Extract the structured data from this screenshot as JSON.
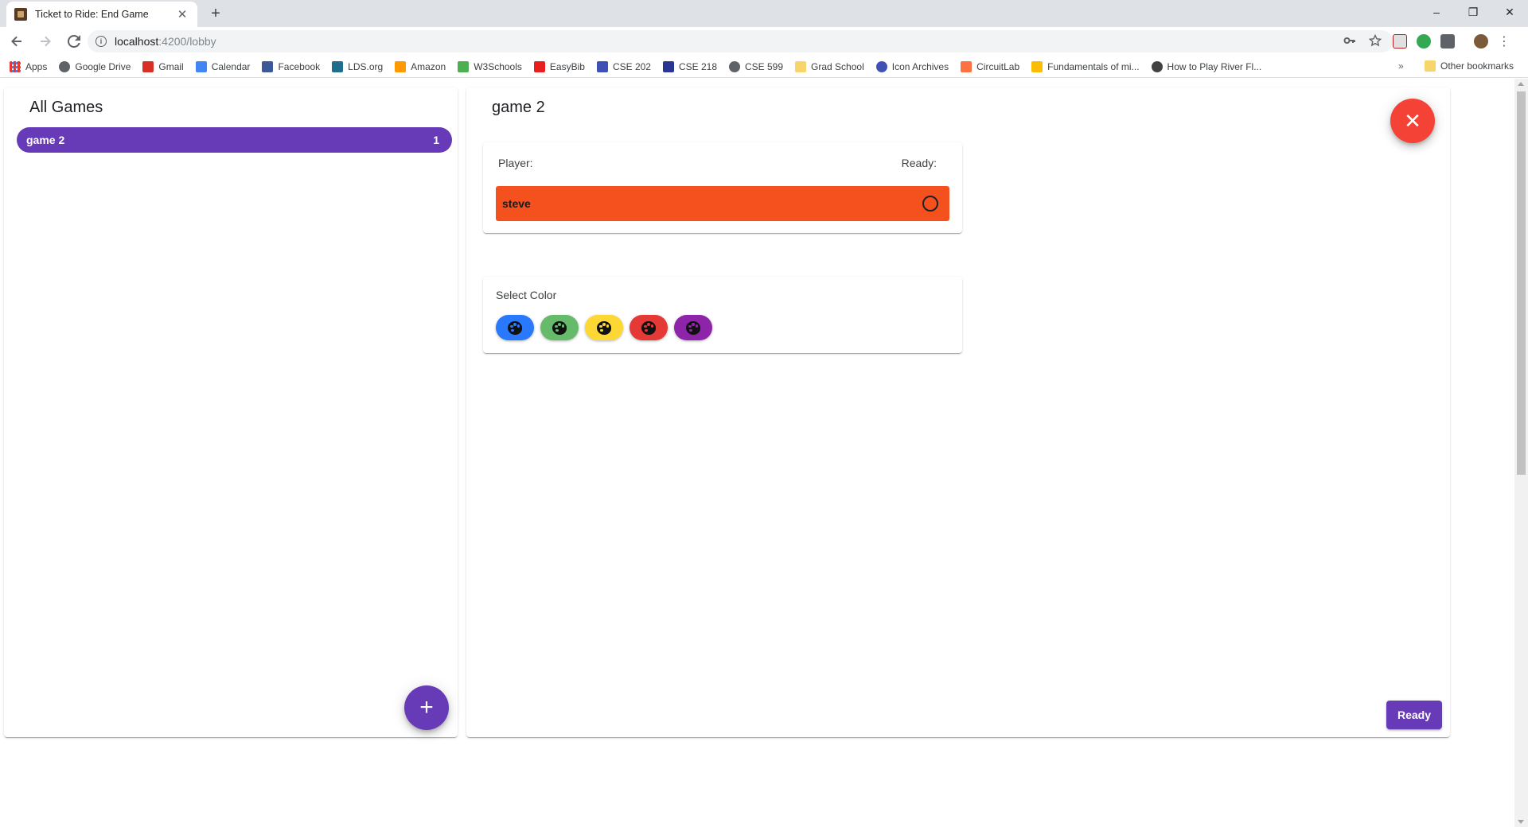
{
  "browser": {
    "tab_title": "Ticket to Ride: End Game",
    "tab_close": "✕",
    "new_tab": "+",
    "url_host": "localhost",
    "url_path": ":4200/lobby",
    "window_controls": [
      "–",
      "❐",
      "✕"
    ]
  },
  "bookmarks": {
    "items": [
      {
        "label": "Apps",
        "icon": "apps-grid-icon",
        "color": "#e53935"
      },
      {
        "label": "Google Drive",
        "icon": "drive-icon",
        "color": "#5f6368"
      },
      {
        "label": "Gmail",
        "icon": "gmail-icon",
        "color": "#d93025"
      },
      {
        "label": "Calendar",
        "icon": "calendar-icon",
        "color": "#4285f4"
      },
      {
        "label": "Facebook",
        "icon": "facebook-icon",
        "color": "#3b5998"
      },
      {
        "label": "LDS.org",
        "icon": "lds-icon",
        "color": "#1e6e8c"
      },
      {
        "label": "Amazon",
        "icon": "amazon-icon",
        "color": "#ff9900"
      },
      {
        "label": "W3Schools",
        "icon": "w3schools-icon",
        "color": "#4caf50"
      },
      {
        "label": "EasyBib",
        "icon": "easybib-icon",
        "color": "#e91e1e"
      },
      {
        "label": "CSE 202",
        "icon": "cse202-icon",
        "color": "#3f51b5"
      },
      {
        "label": "CSE 218",
        "icon": "cse218-icon",
        "color": "#283593"
      },
      {
        "label": "CSE 599",
        "icon": "cse599-icon",
        "color": "#5f6368"
      },
      {
        "label": "Grad School",
        "icon": "folder-icon",
        "color": "#f9d46a"
      },
      {
        "label": "Icon Archives",
        "icon": "icon-archives-icon",
        "color": "#3f51b5"
      },
      {
        "label": "CircuitLab",
        "icon": "circuitlab-icon",
        "color": "#ff7043"
      },
      {
        "label": "Fundamentals of mi...",
        "icon": "drive-icon",
        "color": "#fbbc04"
      },
      {
        "label": "How to Play River Fl...",
        "icon": "river-icon",
        "color": "#424242"
      }
    ],
    "overflow": "»",
    "other_label": "Other bookmarks"
  },
  "lobby": {
    "title": "All Games",
    "games": [
      {
        "name": "game 2",
        "count": "1"
      }
    ],
    "add_label": "+"
  },
  "game": {
    "title": "game 2",
    "close_label": "✕",
    "player_header": "Player:",
    "ready_header": "Ready:",
    "players": [
      {
        "name": "steve",
        "color": "#f4511e",
        "ready": false
      }
    ],
    "select_color_label": "Select Color",
    "colors": [
      {
        "name": "blue",
        "hex": "#2979ff"
      },
      {
        "name": "green",
        "hex": "#66bb6a"
      },
      {
        "name": "yellow",
        "hex": "#fdd835"
      },
      {
        "name": "red",
        "hex": "#e53935"
      },
      {
        "name": "purple",
        "hex": "#8e24aa"
      }
    ],
    "ready_button": "Ready"
  },
  "theme": {
    "primary": "#673ab7",
    "warn": "#f44336"
  }
}
